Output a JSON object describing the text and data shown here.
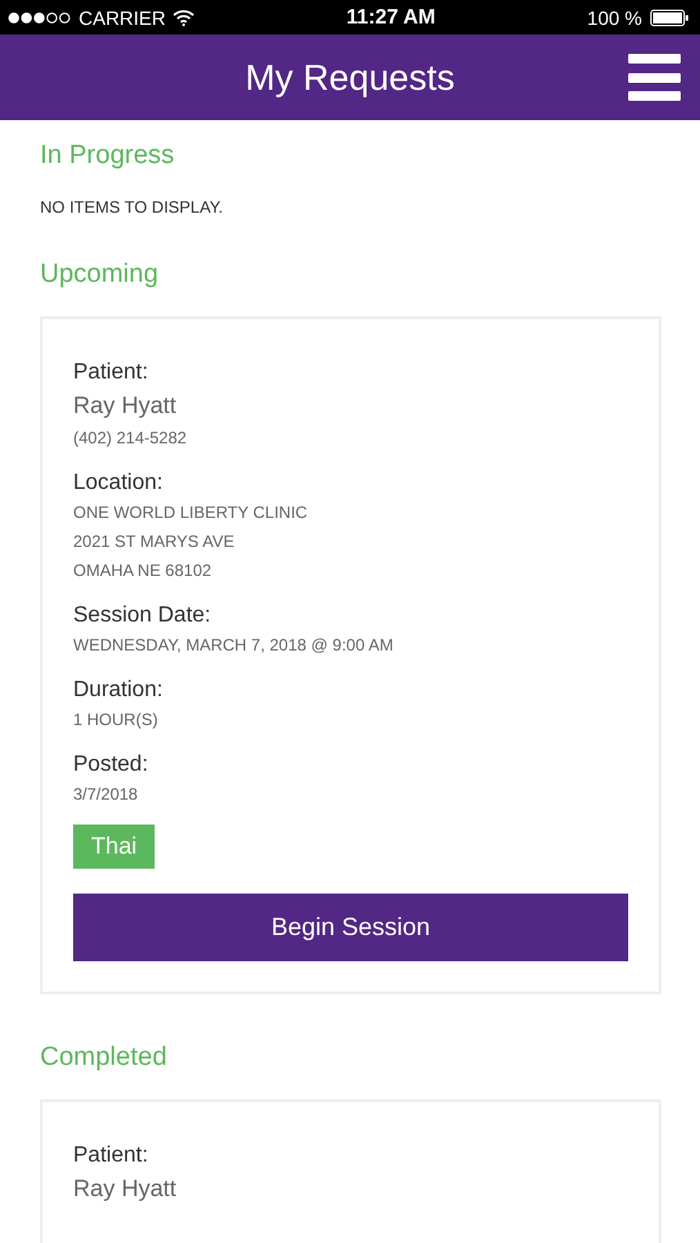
{
  "status_bar": {
    "carrier": "CARRIER",
    "time": "11:27 AM",
    "battery": "100 %"
  },
  "header": {
    "title": "My Requests"
  },
  "sections": [
    {
      "title": "In Progress",
      "empty_text": "NO ITEMS TO DISPLAY."
    },
    {
      "title": "Upcoming",
      "cards": [
        {
          "fields": [
            {
              "label": "Patient:",
              "lines": [
                {
                  "kind": "name",
                  "text": "Ray Hyatt"
                },
                {
                  "kind": "detail",
                  "text": "(402) 214-5282"
                }
              ]
            },
            {
              "label": "Location:",
              "lines": [
                {
                  "kind": "detail",
                  "text": "ONE WORLD LIBERTY CLINIC"
                },
                {
                  "kind": "detail",
                  "text": "2021 ST MARYS AVE"
                },
                {
                  "kind": "detail",
                  "text": "OMAHA NE 68102"
                }
              ]
            },
            {
              "label": "Session Date:",
              "lines": [
                {
                  "kind": "detail",
                  "text": "WEDNESDAY, MARCH 7, 2018 @ 9:00 AM"
                }
              ]
            },
            {
              "label": "Duration:",
              "lines": [
                {
                  "kind": "detail",
                  "text": "1 HOUR(S)"
                }
              ]
            },
            {
              "label": "Posted:",
              "lines": [
                {
                  "kind": "detail",
                  "text": "3/7/2018"
                }
              ]
            }
          ],
          "tag": "Thai",
          "button": "Begin Session"
        }
      ]
    },
    {
      "title": "Completed",
      "cards": [
        {
          "fields": [
            {
              "label": "Patient:",
              "lines": [
                {
                  "kind": "name",
                  "text": "Ray Hyatt"
                }
              ]
            }
          ]
        }
      ]
    }
  ]
}
